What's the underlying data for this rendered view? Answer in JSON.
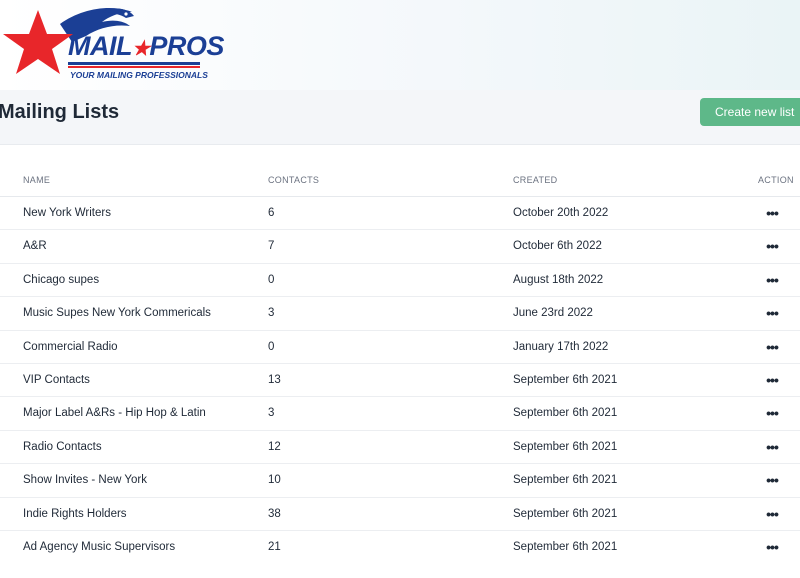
{
  "brand": {
    "logo_text_left": "MAIL",
    "logo_text_right": "PROS",
    "tagline": "YOUR MAILING PROFESSIONALS",
    "colors": {
      "navy": "#1b3f95",
      "red": "#e8262a",
      "accent_green": "#5eb889"
    }
  },
  "page": {
    "title": "Mailing Lists",
    "create_button": "Create new list"
  },
  "table": {
    "columns": [
      "NAME",
      "CONTACTS",
      "CREATED",
      "ACTION"
    ],
    "action_icon": "more-horizontal-icon",
    "rows": [
      {
        "name": "New York Writers",
        "contacts": "6",
        "created": "October 20th 2022",
        "action": "•••"
      },
      {
        "name": "A&R",
        "contacts": "7",
        "created": "October 6th 2022",
        "action": "•••"
      },
      {
        "name": "Chicago supes",
        "contacts": "0",
        "created": "August 18th 2022",
        "action": "•••"
      },
      {
        "name": "Music Supes New York Commericals",
        "contacts": "3",
        "created": "June 23rd 2022",
        "action": "•••"
      },
      {
        "name": "Commercial Radio",
        "contacts": "0",
        "created": "January 17th 2022",
        "action": "•••"
      },
      {
        "name": "VIP Contacts",
        "contacts": "13",
        "created": "September 6th 2021",
        "action": "•••"
      },
      {
        "name": "Major Label A&Rs - Hip Hop & Latin",
        "contacts": "3",
        "created": "September 6th 2021",
        "action": "•••"
      },
      {
        "name": "Radio Contacts",
        "contacts": "12",
        "created": "September 6th 2021",
        "action": "•••"
      },
      {
        "name": "Show Invites - New York",
        "contacts": "10",
        "created": "September 6th 2021",
        "action": "•••"
      },
      {
        "name": "Indie Rights Holders",
        "contacts": "38",
        "created": "September 6th 2021",
        "action": "•••"
      },
      {
        "name": "Ad Agency Music Supervisors",
        "contacts": "21",
        "created": "September 6th 2021",
        "action": "•••"
      }
    ]
  }
}
